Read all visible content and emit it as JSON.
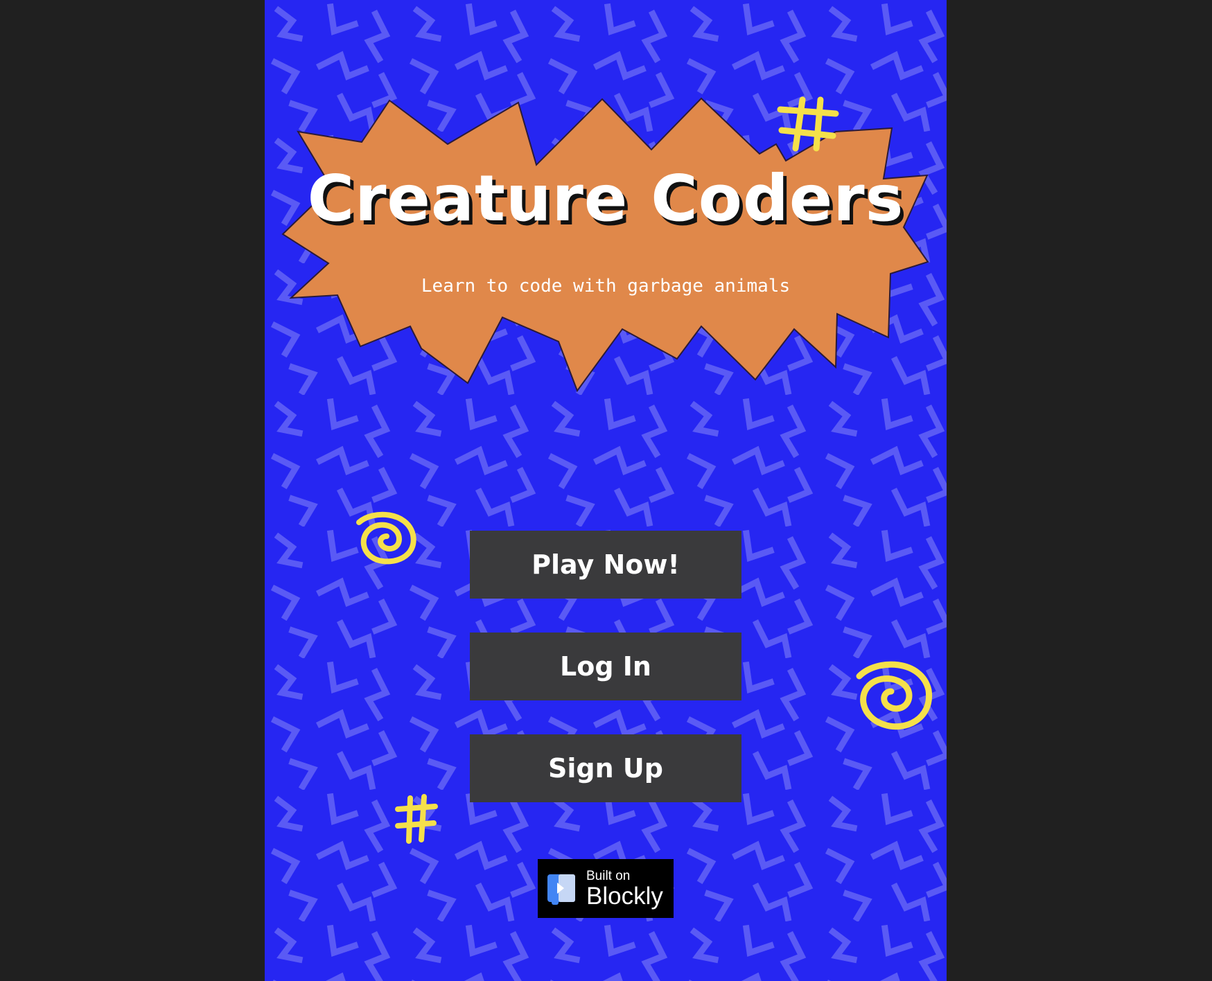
{
  "app": {
    "title": "Creature Coders",
    "subtitle": "Learn to code with garbage animals"
  },
  "buttons": {
    "play": "Play Now!",
    "login": "Log In",
    "signup": "Sign Up"
  },
  "badge": {
    "line1": "Built on",
    "line2": "Blockly"
  },
  "colors": {
    "background": "#2626f2",
    "pattern": "#5a5af5",
    "burst": "#e0884a",
    "button": "#3a3a3c",
    "accent": "#f5e04a",
    "page_surround": "#202020"
  },
  "decorations": [
    "hash-icon",
    "spiral-icon",
    "spiral-icon",
    "hash-icon"
  ]
}
